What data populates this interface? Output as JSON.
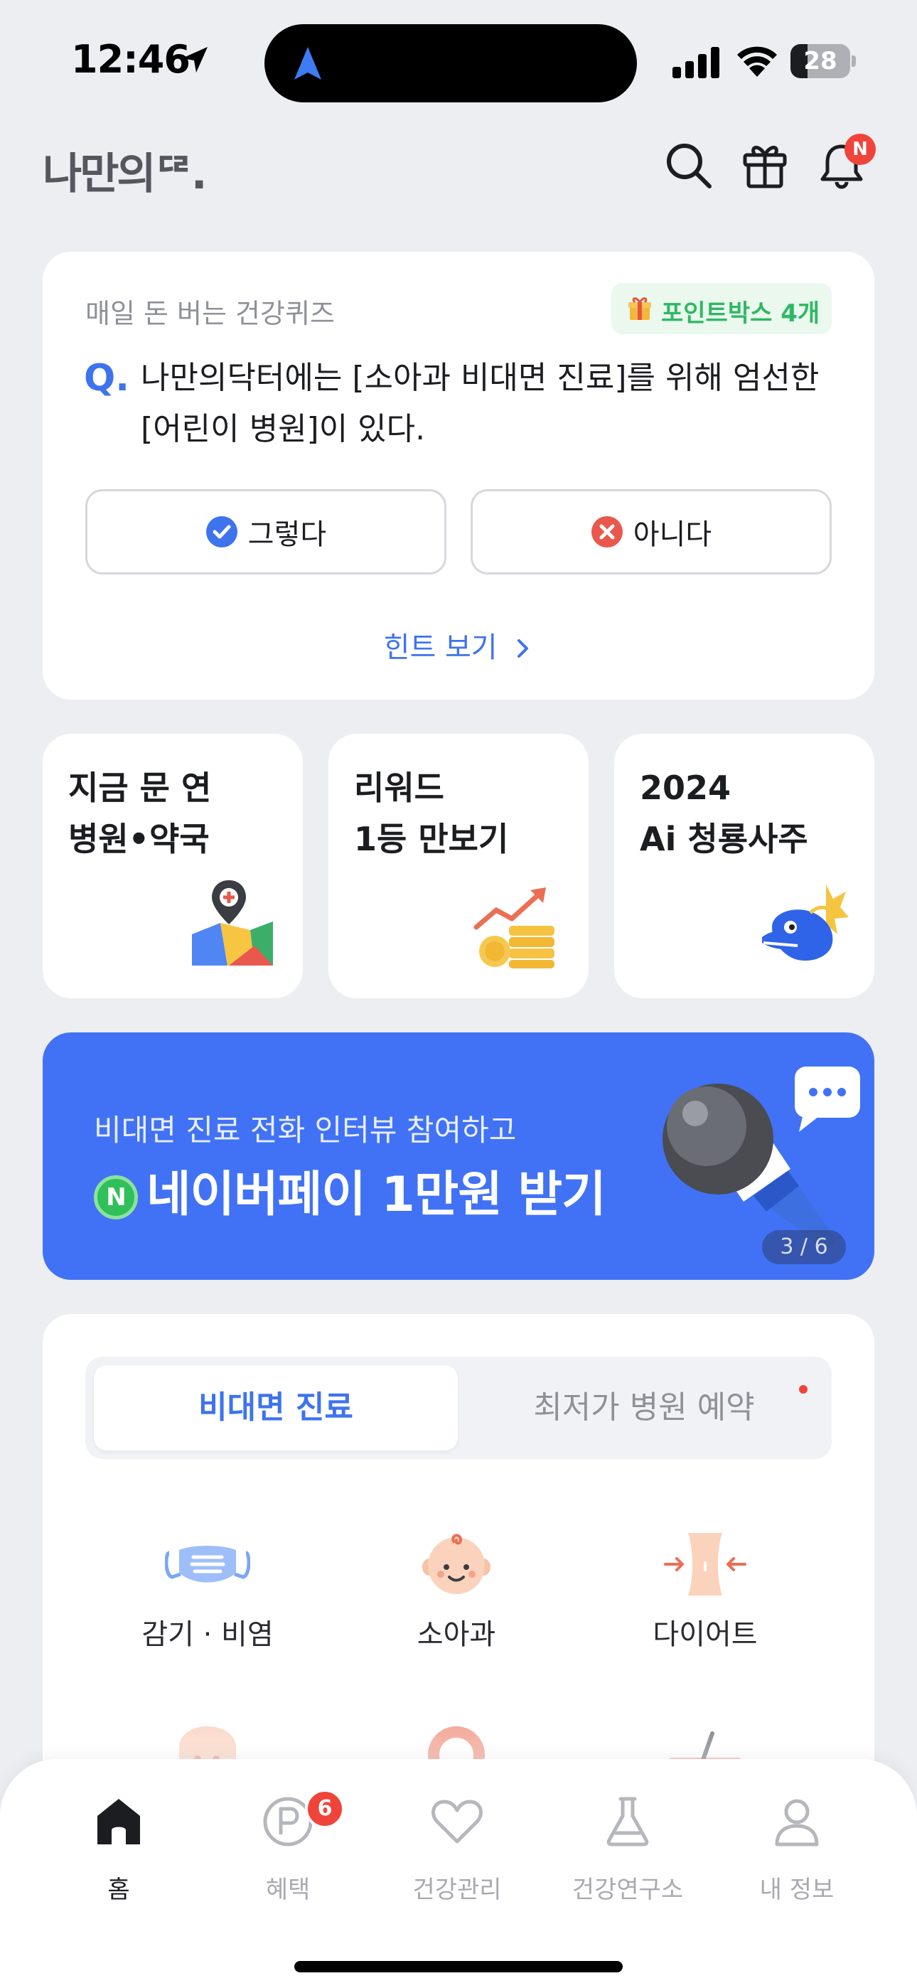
{
  "status_bar": {
    "time": "12:46",
    "battery_percent": "28",
    "battery_level": 0.28
  },
  "header": {
    "logo": "나만의ᄃᄅ.",
    "notification_badge": "N",
    "icons": [
      "search-icon",
      "gift-icon",
      "bell-icon"
    ]
  },
  "quiz": {
    "title": "매일 돈 버는 건강퀴즈",
    "point_badge": "포인트박스 4개",
    "q_mark": "Q.",
    "question_line1": "나만의닥터에는 [소아과 비대면 진료]를 위해 엄선한",
    "question_line2": "[어린이 병원]이 있다.",
    "yes_label": "그렇다",
    "no_label": "아니다",
    "hint_label": "힌트 보기"
  },
  "tiles": [
    {
      "line1": "지금 문 연",
      "line2": "병원•약국",
      "icon": "map-pin-icon"
    },
    {
      "line1": "리워드",
      "line2": "1등 만보기",
      "icon": "coins-chart-icon"
    },
    {
      "line1": "2024",
      "line2": "Ai 청룡사주",
      "icon": "blue-dragon-icon"
    }
  ],
  "banner": {
    "subtitle": "비대면 진료 전화 인터뷰 참여하고",
    "title": "네이버페이 1만원 받기",
    "naver_mark": "N",
    "page_indicator": "3 / 6"
  },
  "services": {
    "tabs": [
      "비대면 진료",
      "최저가 병원 예약"
    ],
    "active_tab": "비대면 진료",
    "items": [
      {
        "label": "감기 · 비염",
        "icon": "mask-icon"
      },
      {
        "label": "소아과",
        "icon": "baby-face-icon"
      },
      {
        "label": "다이어트",
        "icon": "waist-icon"
      }
    ]
  },
  "tab_bar": {
    "items": [
      {
        "label": "홈",
        "icon": "home-icon"
      },
      {
        "label": "혜택",
        "icon": "point-icon",
        "badge": "6"
      },
      {
        "label": "건강관리",
        "icon": "heart-icon"
      },
      {
        "label": "건강연구소",
        "icon": "flask-icon"
      },
      {
        "label": "내 정보",
        "icon": "person-icon"
      }
    ],
    "active": "홈"
  },
  "colors": {
    "accent": "#3e73ee",
    "banner": "#4172f5",
    "badge_red": "#f0443a",
    "point_green": "#2fb864",
    "background": "#edeef2"
  }
}
